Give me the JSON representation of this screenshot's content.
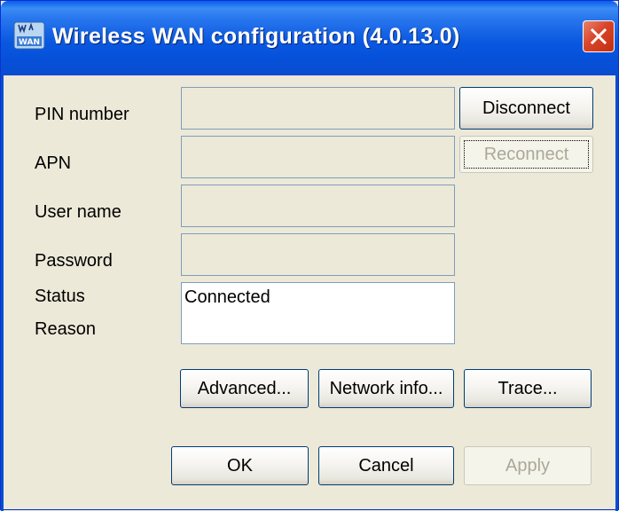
{
  "window": {
    "title": "Wireless WAN configuration (4.0.13.0)",
    "icon": "wwan-app-icon"
  },
  "fields": {
    "pin": {
      "label": "PIN number",
      "value": ""
    },
    "apn": {
      "label": "APN",
      "value": ""
    },
    "username": {
      "label": "User name",
      "value": ""
    },
    "password": {
      "label": "Password",
      "value": ""
    },
    "status_label": "Status",
    "reason_label": "Reason",
    "status_value": "Connected"
  },
  "buttons": {
    "disconnect": "Disconnect",
    "reconnect": "Reconnect",
    "advanced": "Advanced...",
    "network_info": "Network info...",
    "trace": "Trace...",
    "ok": "OK",
    "cancel": "Cancel",
    "apply": "Apply"
  },
  "colors": {
    "titlebar": "#0a58e0",
    "close": "#d9442a",
    "face": "#ece9d8",
    "field_border": "#7f9db9"
  }
}
